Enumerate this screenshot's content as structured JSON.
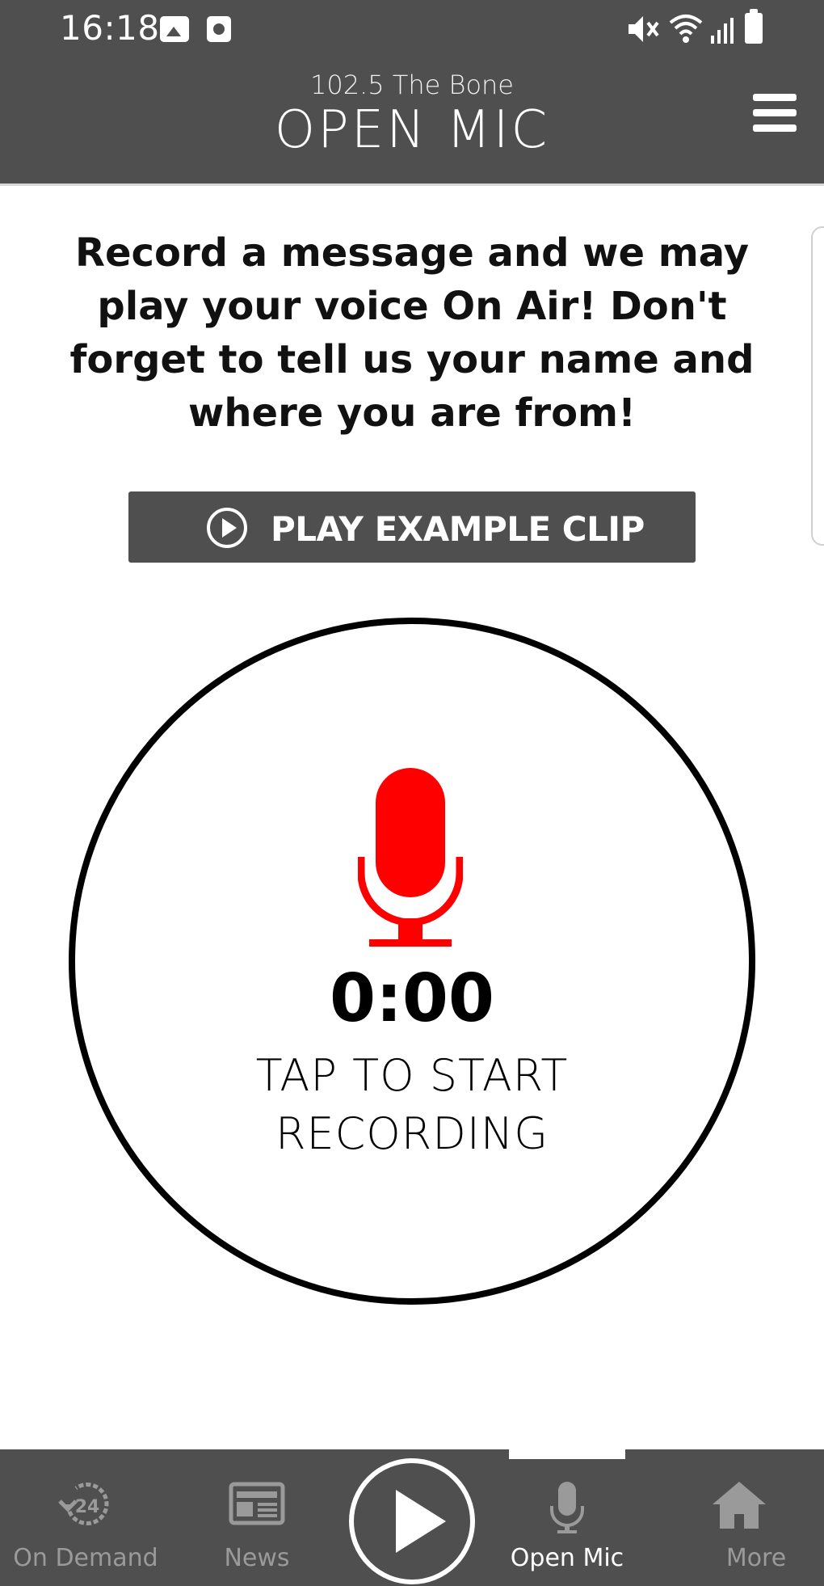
{
  "status_bar": {
    "time": "16:18",
    "icons": [
      "gallery-icon",
      "screen-record-icon",
      "mute-icon",
      "wifi-icon",
      "signal-icon",
      "battery-icon"
    ]
  },
  "header": {
    "station": "102.5 The Bone",
    "title": "OPEN MIC",
    "menu_icon": "hamburger-menu-icon"
  },
  "main": {
    "instructions": "Record a message and we may play your voice On Air! Don't forget to tell us your name and where you are from!",
    "play_example_label": "PLAY EXAMPLE CLIP",
    "timer": "0:00",
    "record_prompt_line1": "TAP TO START",
    "record_prompt_line2": "RECORDING"
  },
  "bottom_nav": {
    "items": [
      {
        "label": "On Demand",
        "icon": "on-demand-24-icon",
        "active": false
      },
      {
        "label": "News",
        "icon": "newspaper-icon",
        "active": false
      },
      {
        "label": "Open Mic",
        "icon": "microphone-icon",
        "active": true
      },
      {
        "label": "More",
        "icon": "home-icon",
        "active": false
      }
    ],
    "center_icon": "play-icon"
  },
  "colors": {
    "bar_gray": "#4f4f4f",
    "mic_red": "#ff0000",
    "inactive_nav": "#9a9a9a"
  }
}
